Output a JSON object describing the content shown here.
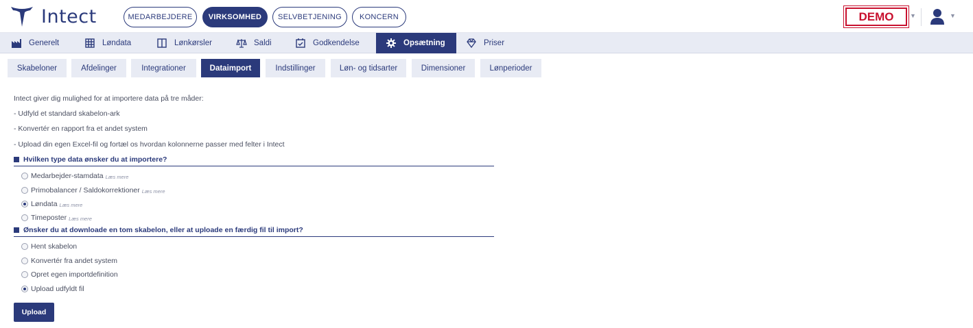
{
  "brand": {
    "name": "Intect"
  },
  "topnav": [
    {
      "label": "MEDARBEJDERE"
    },
    {
      "label": "VIRKSOMHED"
    },
    {
      "label": "SELVBETJENING"
    },
    {
      "label": "KONCERN"
    }
  ],
  "demo_label": "DEMO",
  "mainnav": [
    {
      "label": "Generelt",
      "icon": "factory-icon"
    },
    {
      "label": "Løndata",
      "icon": "grid-icon"
    },
    {
      "label": "Lønkørsler",
      "icon": "book-icon"
    },
    {
      "label": "Saldi",
      "icon": "scale-icon"
    },
    {
      "label": "Godkendelse",
      "icon": "calendar-check-icon"
    },
    {
      "label": "Opsætning",
      "icon": "gear-icon"
    },
    {
      "label": "Priser",
      "icon": "diamond-icon"
    }
  ],
  "subtabs": [
    {
      "label": "Skabeloner"
    },
    {
      "label": "Afdelinger"
    },
    {
      "label": "Integrationer"
    },
    {
      "label": "Dataimport"
    },
    {
      "label": "Indstillinger"
    },
    {
      "label": "Løn- og tidsarter"
    },
    {
      "label": "Dimensioner"
    },
    {
      "label": "Lønperioder"
    }
  ],
  "intro": [
    "Intect giver dig mulighed for at importere data på tre måder:",
    "- Udfyld et standard skabelon-ark",
    "- Konvertér en rapport fra et andet system",
    "- Upload din egen Excel-fil og fortæl os hvordan kolonnerne passer med felter i Intect"
  ],
  "q1": {
    "title": "Hvilken type data ønsker du at importere?",
    "options": [
      {
        "label": "Medarbejder-stamdata",
        "readmore": "Læs mere"
      },
      {
        "label": "Primobalancer / Saldokorrektioner",
        "readmore": "Læs mere"
      },
      {
        "label": "Løndata",
        "readmore": "Læs mere"
      },
      {
        "label": "Timeposter",
        "readmore": "Læs mere"
      }
    ],
    "selected": "Løndata"
  },
  "q2": {
    "title": "Ønsker du at downloade en tom skabelon, eller at uploade en færdig fil til import?",
    "options": [
      {
        "label": "Hent skabelon"
      },
      {
        "label": "Konvertér fra andet system"
      },
      {
        "label": "Opret egen importdefinition"
      },
      {
        "label": "Upload udfyldt fil"
      }
    ],
    "selected": "Upload udfyldt fil"
  },
  "upload_button": "Upload",
  "colors": {
    "primary": "#2b3a7b",
    "nav_bg": "#e8ebf4",
    "demo_red": "#c8102e"
  }
}
